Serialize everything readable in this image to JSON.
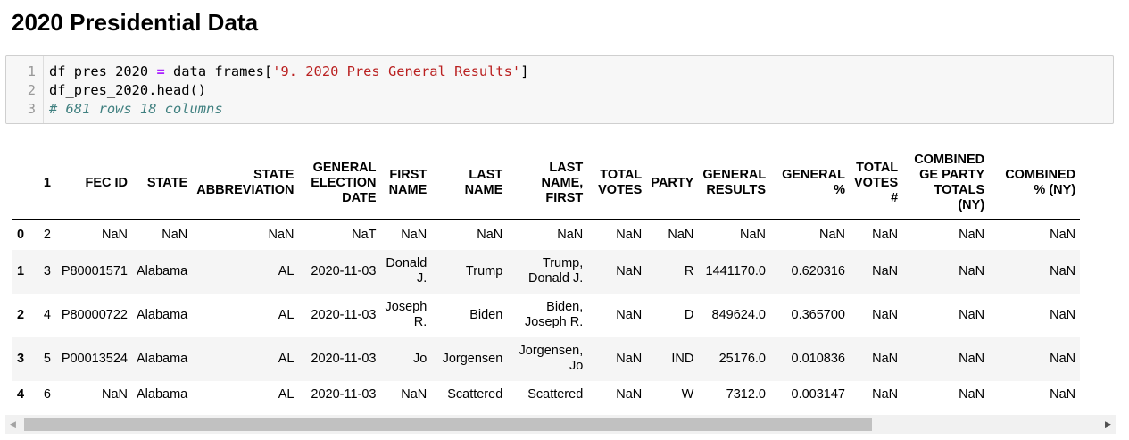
{
  "heading": "2020 Presidential Data",
  "code_cell": {
    "lines": [
      {
        "no": "1",
        "parts": [
          {
            "t": "df_pres_2020 ",
            "c": ""
          },
          {
            "t": "=",
            "c": "tok-op"
          },
          {
            "t": " data_frames[",
            "c": ""
          },
          {
            "t": "'9. 2020 Pres General Results'",
            "c": "tok-str"
          },
          {
            "t": "]",
            "c": ""
          }
        ]
      },
      {
        "no": "2",
        "parts": [
          {
            "t": "df_pres_2020.head()",
            "c": ""
          }
        ]
      },
      {
        "no": "3",
        "parts": [
          {
            "t": "# 681 rows 18 columns",
            "c": "tok-comment"
          }
        ]
      }
    ]
  },
  "table": {
    "columns": [
      "",
      "1",
      "FEC ID",
      "STATE",
      "STATE ABBREVIATION",
      "GENERAL ELECTION DATE",
      "FIRST NAME",
      "LAST NAME",
      "LAST NAME, FIRST",
      "TOTAL VOTES",
      "PARTY",
      "GENERAL RESULTS",
      "GENERAL %",
      "TOTAL VOTES #",
      "COMBINED GE PARTY TOTALS (NY)",
      "COMBINED % (NY)"
    ],
    "rows": [
      [
        "0",
        "2",
        "NaN",
        "NaN",
        "NaN",
        "NaT",
        "NaN",
        "NaN",
        "NaN",
        "NaN",
        "NaN",
        "NaN",
        "NaN",
        "NaN",
        "NaN",
        "NaN"
      ],
      [
        "1",
        "3",
        "P80001571",
        "Alabama",
        "AL",
        "2020-11-03",
        "Donald J.",
        "Trump",
        "Trump, Donald J.",
        "NaN",
        "R",
        "1441170.0",
        "0.620316",
        "NaN",
        "NaN",
        "NaN"
      ],
      [
        "2",
        "4",
        "P80000722",
        "Alabama",
        "AL",
        "2020-11-03",
        "Joseph R.",
        "Biden",
        "Biden, Joseph R.",
        "NaN",
        "D",
        "849624.0",
        "0.365700",
        "NaN",
        "NaN",
        "NaN"
      ],
      [
        "3",
        "5",
        "P00013524",
        "Alabama",
        "AL",
        "2020-11-03",
        "Jo",
        "Jorgensen",
        "Jorgensen, Jo",
        "NaN",
        "IND",
        "25176.0",
        "0.010836",
        "NaN",
        "NaN",
        "NaN"
      ],
      [
        "4",
        "6",
        "NaN",
        "Alabama",
        "AL",
        "2020-11-03",
        "NaN",
        "Scattered",
        "Scattered",
        "NaN",
        "W",
        "7312.0",
        "0.003147",
        "NaN",
        "NaN",
        "NaN"
      ]
    ]
  },
  "scrollbar": {
    "left_arrow": "◀",
    "right_arrow": "▶",
    "thumb_fraction": 0.79
  }
}
